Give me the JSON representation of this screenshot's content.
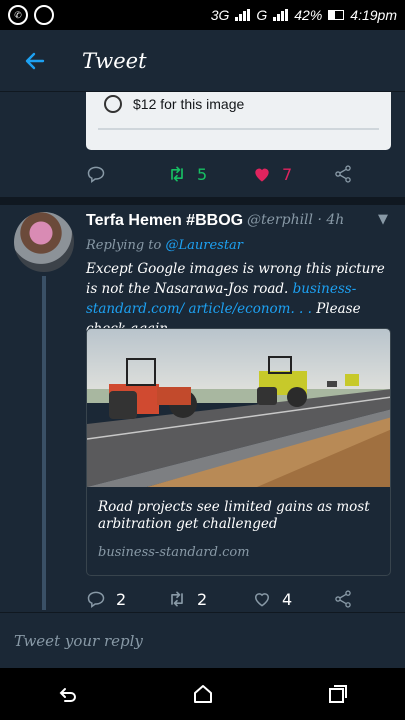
{
  "status_bar": {
    "network": "3G",
    "carrier_indicator": "G",
    "battery": "42%",
    "battery_fraction": 0.42,
    "time": "4:19pm"
  },
  "header": {
    "title": "Tweet",
    "back_icon": "arrow-left-icon"
  },
  "previous_tweet": {
    "option_label": "$12 for this image",
    "retweet_count": "5",
    "like_count": "7"
  },
  "tweet": {
    "name": "Terfa Hemen #BBOG",
    "handle": "@terphill",
    "time": "· 4h",
    "replying_prefix": "Replying to ",
    "replying_to": "@Laurestar",
    "text_1": "Except Google images is wrong this picture is not the Nasarawa-Jos road. ",
    "link": "business-standard.com/ article/econom. . .",
    "text_2": " Please check again.",
    "card": {
      "title": "Road projects see limited gains as most arbitration get challenged",
      "domain": "business-standard.com"
    },
    "reply_count": "2",
    "retweet_count": "2",
    "like_count": "4"
  },
  "reply_input": {
    "placeholder": "Tweet your reply"
  },
  "colors": {
    "accent": "#1da1f2",
    "like": "#e0245e",
    "retweet": "#17bf63",
    "background": "#1b2836"
  }
}
